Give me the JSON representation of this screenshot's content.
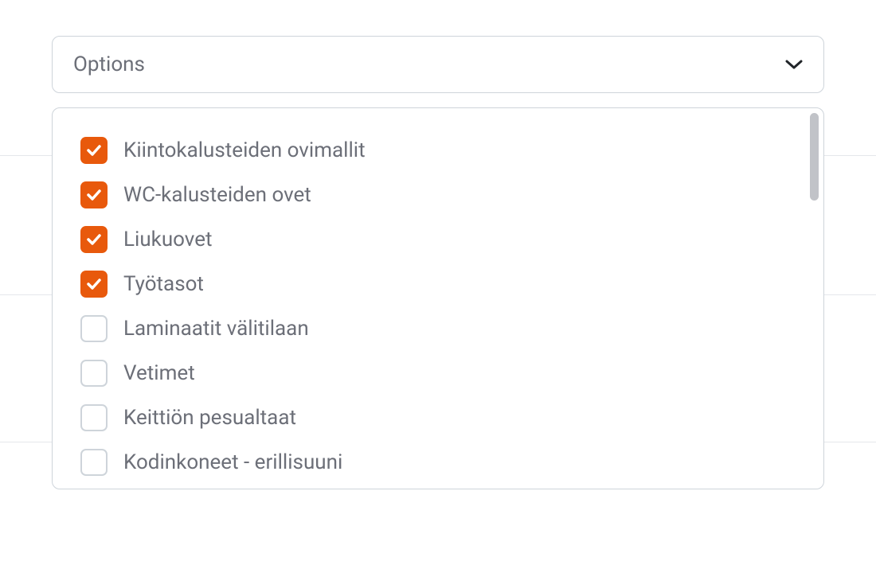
{
  "select": {
    "placeholder": "Options"
  },
  "options": [
    {
      "label": "Kiintokalusteiden ovimallit",
      "checked": true
    },
    {
      "label": "WC-kalusteiden ovet",
      "checked": true
    },
    {
      "label": "Liukuovet",
      "checked": true
    },
    {
      "label": "Työtasot",
      "checked": true
    },
    {
      "label": "Laminaatit välitilaan",
      "checked": false
    },
    {
      "label": "Vetimet",
      "checked": false
    },
    {
      "label": "Keittiön pesualtaat",
      "checked": false
    },
    {
      "label": "Kodinkoneet - erillisuuni",
      "checked": false
    }
  ],
  "colors": {
    "accent": "#e8590c",
    "border": "#ced4da",
    "text": "#6c6f78"
  }
}
